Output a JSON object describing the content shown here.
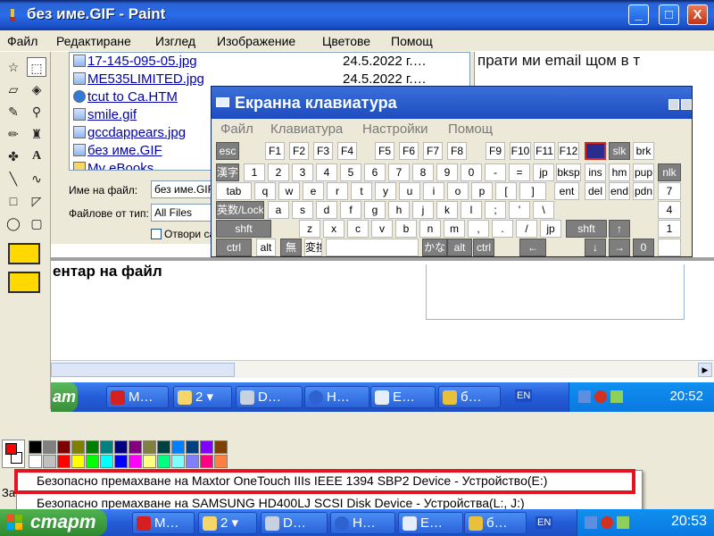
{
  "window": {
    "title": "без име.GIF - Paint",
    "minimize": "_",
    "maximize": "□",
    "close": "X"
  },
  "menubar": [
    "Файл",
    "Редактиране",
    "Изглед",
    "Изображение",
    "Цветове",
    "Помощ"
  ],
  "canvas": {
    "files": [
      {
        "name": "17-145-095-05.jpg",
        "date": "24.5.2022 г.…",
        "icon": "image-file-icon"
      },
      {
        "name": "ME535LIMITED.jpg",
        "date": "24.5.2022 г.…",
        "icon": "image-file-icon"
      },
      {
        "name": "tcut to Ca.HTM",
        "date": "",
        "icon": "html-file-icon"
      },
      {
        "name": "smile.gif",
        "date": "",
        "icon": "image-file-icon"
      },
      {
        "name": "gccdappears.jpg",
        "date": "",
        "icon": "image-file-icon"
      },
      {
        "name": "без име.GIF",
        "date": "",
        "icon": "image-file-icon"
      },
      {
        "name": "My eBooks",
        "date": "",
        "icon": "folder-icon"
      }
    ],
    "filename_label": "Име на файл:",
    "filename_value": "без име.GIF",
    "filetype_label": "Файлове от тип:",
    "filetype_value": "All Files",
    "open_readonly": "Отвори са",
    "email_text": "прати ми email щом в т",
    "comment_text": "ентар на файл",
    "inner_taskbar": {
      "start": "ат",
      "tasks": [
        "М…",
        "2",
        "D…",
        "Н…",
        "Е…",
        "б…"
      ],
      "lang": "EN",
      "clock": "20:52"
    }
  },
  "osk": {
    "title": "Екранна клавиатура",
    "menu": [
      "Файл",
      "Клавиатура",
      "Настройки",
      "Помощ"
    ],
    "rows": [
      [
        "esc",
        "F1",
        "F2",
        "F3",
        "F4",
        "F5",
        "F6",
        "F7",
        "F8",
        "F9",
        "F10",
        "F11",
        "F12",
        "",
        "slk",
        "brk"
      ],
      [
        "漢字",
        "1",
        "2",
        "3",
        "4",
        "5",
        "6",
        "7",
        "8",
        "9",
        "0",
        "-",
        "=",
        "jp",
        "bksp",
        "ins",
        "hm",
        "pup",
        "nlk"
      ],
      [
        "tab",
        "q",
        "w",
        "e",
        "r",
        "t",
        "y",
        "u",
        "i",
        "o",
        "p",
        "[",
        "]",
        "ent",
        "del",
        "end",
        "pdn",
        "7"
      ],
      [
        "英数/Lock",
        "a",
        "s",
        "d",
        "f",
        "g",
        "h",
        "j",
        "k",
        "l",
        ";",
        "'",
        "\\",
        "4"
      ],
      [
        "shft",
        "z",
        "x",
        "c",
        "v",
        "b",
        "n",
        "m",
        ",",
        ".",
        "/",
        "jp",
        "shft",
        "↑",
        "1"
      ],
      [
        "ctrl",
        "alt",
        "無",
        "変換",
        "かな",
        "alt",
        "ctrl",
        "←",
        "↓",
        "→",
        "0"
      ]
    ]
  },
  "palette": {
    "foreground": "#ff0000",
    "background": "#ffffff",
    "colors_top": [
      "#000000",
      "#808080",
      "#800000",
      "#808000",
      "#008000",
      "#008080",
      "#000080",
      "#800080",
      "#808040",
      "#004040",
      "#0080ff",
      "#004080",
      "#8000ff",
      "#804000"
    ],
    "colors_bottom": [
      "#ffffff",
      "#c0c0c0",
      "#ff0000",
      "#ffff00",
      "#00ff00",
      "#00ffff",
      "#0000ff",
      "#ff00ff",
      "#ffff80",
      "#00ff80",
      "#80ffff",
      "#8080ff",
      "#ff0080",
      "#ff8040"
    ]
  },
  "statusbar": {
    "text": "За"
  },
  "popup": {
    "items": [
      "Безопасно премахване на Maxtor OneTouch IIIs IEEE 1394 SBP2 Device - Устройство(E:)",
      "Безопасно премахване на SAMSUNG HD400LJ SCSI Disk Device - Устройства(L:, J:)"
    ]
  },
  "taskbar": {
    "start": "старт",
    "tasks": [
      "М…",
      "2",
      "D…",
      "Н…",
      "Е…",
      "б…"
    ],
    "lang": "EN",
    "clock": "20:53"
  }
}
